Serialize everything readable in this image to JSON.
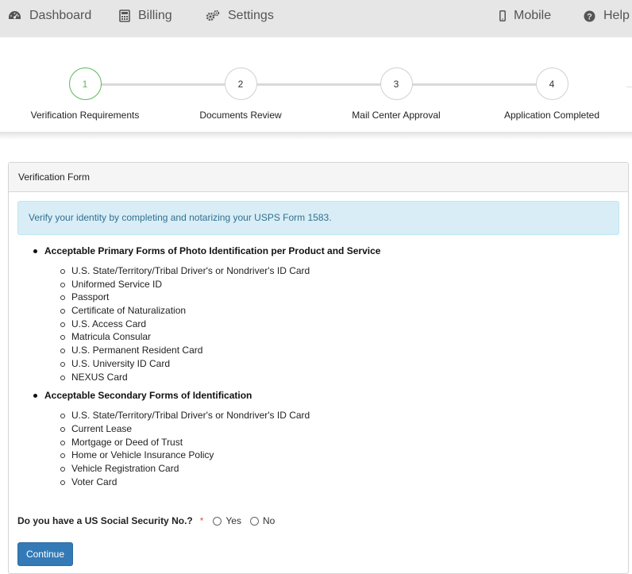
{
  "nav": {
    "dashboard": "Dashboard",
    "billing": "Billing",
    "settings": "Settings",
    "mobile": "Mobile",
    "help": "Help"
  },
  "stepper": {
    "steps": [
      {
        "number": "1",
        "label": "Verification Requirements",
        "state": "active"
      },
      {
        "number": "2",
        "label": "Documents Review",
        "state": "pending"
      },
      {
        "number": "3",
        "label": "Mail Center Approval",
        "state": "pending"
      },
      {
        "number": "4",
        "label": "Application Completed",
        "state": "pending"
      }
    ],
    "active_color": "#5cb85c"
  },
  "panel": {
    "title": "Verification Form",
    "alert": "Verify your identity by completing and notarizing your USPS Form 1583.",
    "primary": {
      "title": "Acceptable Primary Forms of Photo Identification per Product and Service",
      "items": [
        "U.S. State/Territory/Tribal Driver's or Nondriver's ID Card",
        "Uniformed Service ID",
        "Passport",
        "Certificate of Naturalization",
        "U.S. Access Card",
        "Matricula Consular",
        "U.S. Permanent Resident Card",
        "U.S. University ID Card",
        "NEXUS Card"
      ]
    },
    "secondary": {
      "title": "Acceptable Secondary Forms of Identification",
      "items": [
        "U.S. State/Territory/Tribal Driver's or Nondriver's ID Card",
        "Current Lease",
        "Mortgage or Deed of Trust",
        "Home or Vehicle Insurance Policy",
        "Vehicle Registration Card",
        "Voter Card"
      ]
    },
    "ssn_question": "Do you have a US Social Security No.?",
    "required_mark": "*",
    "options": {
      "yes": "Yes",
      "no": "No"
    },
    "continue_label": "Continue"
  },
  "colors": {
    "primary_button": "#337ab7",
    "alert_bg": "#d9edf7",
    "alert_text": "#31708f",
    "required": "#d9534f"
  }
}
